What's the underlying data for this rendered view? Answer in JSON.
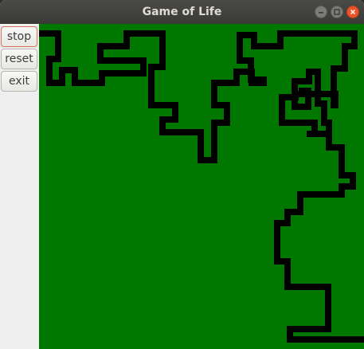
{
  "window": {
    "title": "Game of Life"
  },
  "controls": {
    "stop_label": "stop",
    "reset_label": "reset",
    "exit_label": "exit"
  },
  "board": {
    "background_color": "#007800",
    "cell_color": "#000000"
  }
}
